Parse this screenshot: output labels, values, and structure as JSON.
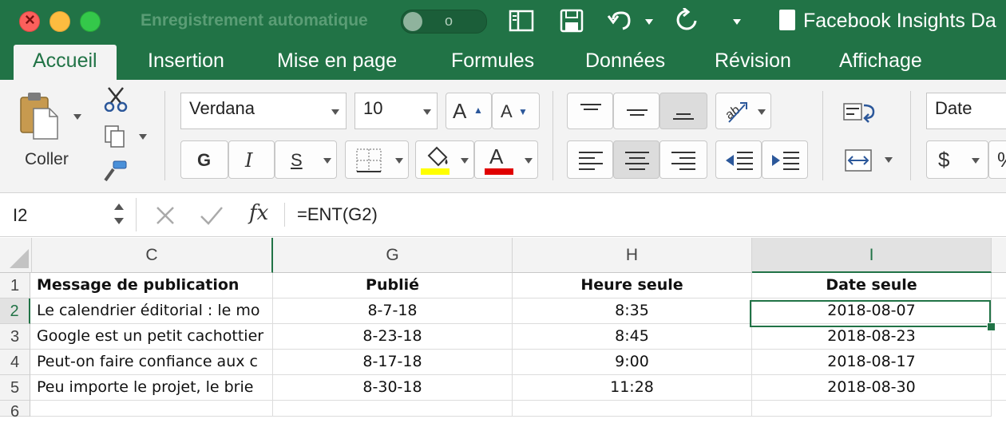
{
  "titlebar": {
    "autosave_label": "Enregistrement automatique",
    "toggle_state": "o",
    "doc_title": "Facebook Insights Da",
    "accent_color": "#217346",
    "icons": [
      "sidebar-icon",
      "save-icon",
      "undo-icon",
      "redo-icon",
      "customize-icon"
    ]
  },
  "tabs": [
    "Accueil",
    "Insertion",
    "Mise en page",
    "Formules",
    "Données",
    "Révision",
    "Affichage"
  ],
  "ribbon": {
    "paste_label": "Coller",
    "font_name": "Verdana",
    "font_size": "10",
    "bold": "G",
    "italic": "I",
    "underline": "S",
    "number_format": "Date",
    "currency_symbol": "$",
    "percent_symbol": "%",
    "grow_font": "A",
    "shrink_font": "A",
    "font_color_letter": "A",
    "fill_color": "#ffff00",
    "font_color": "#e00000"
  },
  "formula_bar": {
    "name_box": "I2",
    "fx": "fx",
    "formula": "=ENT(G2)"
  },
  "sheet": {
    "columns": [
      "C",
      "G",
      "H",
      "I"
    ],
    "row_numbers": [
      "1",
      "2",
      "3",
      "4",
      "5",
      "6"
    ],
    "header_row": [
      "Message de publication",
      "Publié",
      "Heure seule",
      "Date seule"
    ],
    "rows": [
      [
        "Le calendrier éditorial : le mo",
        "8-7-18",
        "8:35",
        "2018-08-07"
      ],
      [
        "Google est un petit cachottier",
        "8-23-18",
        "8:45",
        "2018-08-23"
      ],
      [
        "Peut-on faire confiance aux c",
        "8-17-18",
        "9:00",
        "2018-08-17"
      ],
      [
        "Peu importe le projet, le brie",
        "8-30-18",
        "11:28",
        "2018-08-30"
      ]
    ]
  }
}
